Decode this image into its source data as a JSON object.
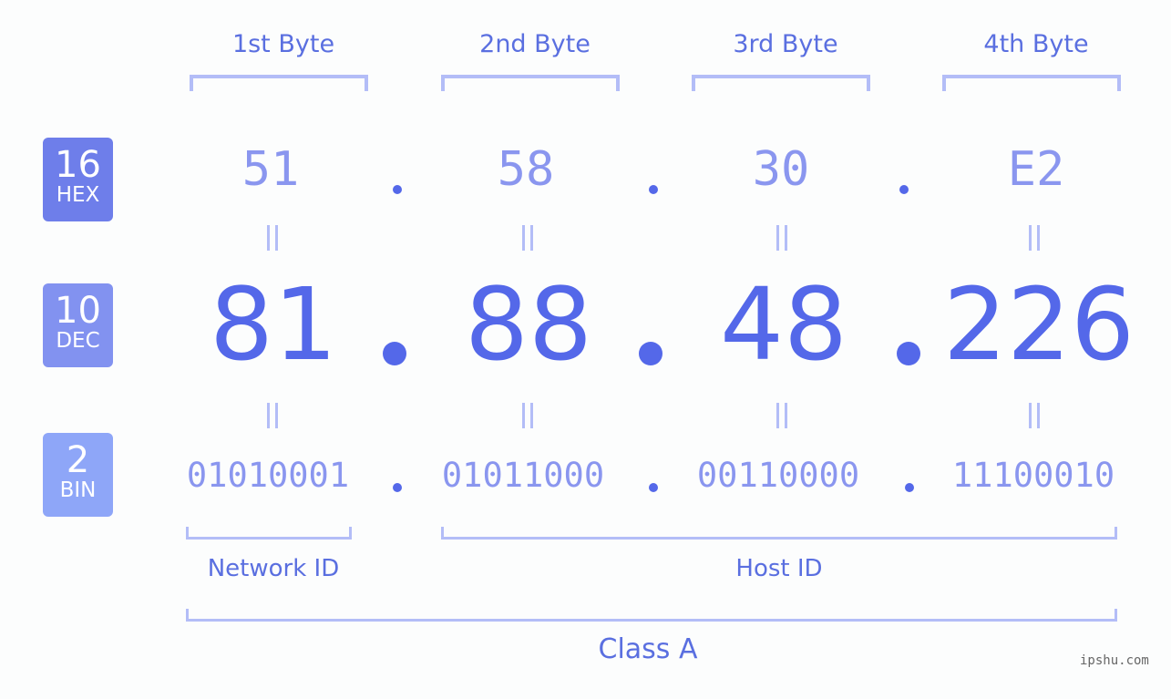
{
  "headers": [
    "1st Byte",
    "2nd Byte",
    "3rd Byte",
    "4th Byte"
  ],
  "badges": {
    "hex": {
      "num": "16",
      "label": "HEX",
      "color": "#6e7eea"
    },
    "dec": {
      "num": "10",
      "label": "DEC",
      "color": "#8292f0"
    },
    "bin": {
      "num": "2",
      "label": "BIN",
      "color": "#8ea6f8"
    }
  },
  "hex": [
    "51",
    "58",
    "30",
    "E2"
  ],
  "dec": [
    "81",
    "88",
    "48",
    "226"
  ],
  "bin": [
    "01010001",
    "01011000",
    "00110000",
    "11100010"
  ],
  "labels": {
    "network": "Network ID",
    "host": "Host ID",
    "class": "Class A"
  },
  "watermark": "ipshu.com",
  "colors": {
    "accent": "#5468e9",
    "light": "#b3bdf7",
    "muted": "#8a96ef"
  }
}
